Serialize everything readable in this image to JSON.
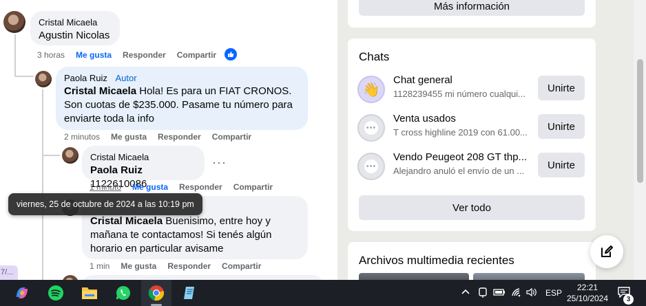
{
  "comments": [
    {
      "author": "Cristal Micaela",
      "text_name": "Agustin Nicolas",
      "time": "3 horas",
      "like": "Me gusta",
      "reply": "Responder",
      "share": "Compartir"
    },
    {
      "author": "Paola Ruiz",
      "tag": "Autor",
      "mention": "Cristal Micaela",
      "text": "Hola! Es para un FIAT CRONOS. Son cuotas de $235.000. Pasame tu número para enviarte toda la info",
      "time": "2 minutos",
      "like": "Me gusta",
      "reply": "Responder",
      "share": "Compartir"
    },
    {
      "author": "Cristal Micaela",
      "mention": "Paola Ruiz",
      "text": "1122610086",
      "time": "1 minuto",
      "like": "Me gusta",
      "reply": "Responder",
      "share": "Compartir"
    },
    {
      "mention": "Cristal Micaela",
      "text": "Buenisimo, entre hoy y mañana te contactamos! Si tenés algún horario en particular avisame",
      "time": "1 min",
      "like": "Me gusta",
      "reply": "Responder",
      "share": "Compartir"
    }
  ],
  "tooltip": "viernes, 25 de octubre de 2024 a las 10:19 pm",
  "left_fragment": "7/...",
  "right": {
    "more_info": "Más información",
    "chats_title": "Chats",
    "chats": [
      {
        "name": "Chat general",
        "preview": "1128239455 mi número cualqui...",
        "join": "Unirte"
      },
      {
        "name": "Venta usados",
        "preview": "T cross highline 2019 con 61.00...",
        "join": "Unirte"
      },
      {
        "name": "Vendo Peugeot 208 GT thp...",
        "preview": "Alejandro anuló el envío de un ...",
        "join": "Unirte"
      }
    ],
    "see_all": "Ver todo",
    "media_title": "Archivos multimedia recientes"
  },
  "taskbar": {
    "lang": "ESP",
    "time": "22:21",
    "date": "25/10/2024",
    "notif_count": "3"
  },
  "colors": {
    "accent": "#0866ff",
    "gray_button": "#e4e6eb",
    "taskbar": "#1c2026"
  }
}
